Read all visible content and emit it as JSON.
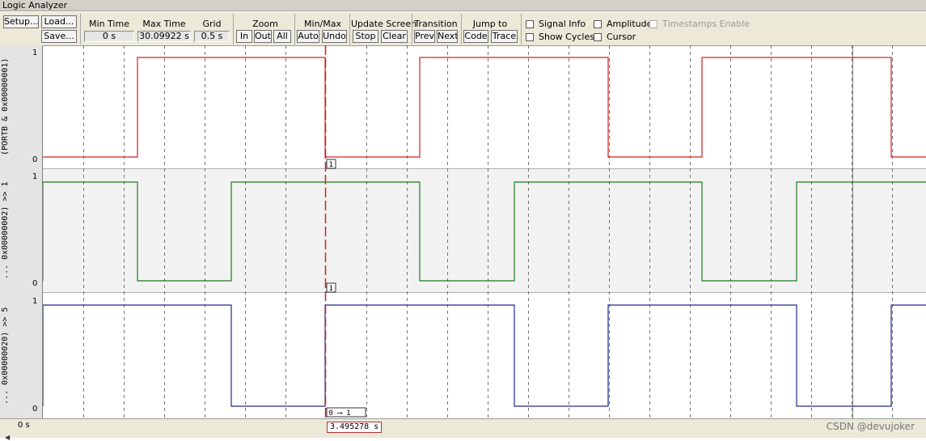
{
  "window": {
    "title": "Logic Analyzer"
  },
  "toolbar": {
    "setup_label": "Setup...",
    "load_label": "Load...",
    "save_label": "Save...",
    "min_time": {
      "label": "Min Time",
      "value": "0 s"
    },
    "max_time": {
      "label": "Max Time",
      "value": "30.09922 s"
    },
    "grid": {
      "label": "Grid",
      "value": "0.5 s"
    },
    "zoom": {
      "label": "Zoom",
      "in": "In",
      "out": "Out",
      "all": "All"
    },
    "minmax": {
      "label": "Min/Max",
      "auto": "Auto",
      "undo": "Undo"
    },
    "update": {
      "label": "Update Screen",
      "stop": "Stop",
      "clear": "Clear"
    },
    "transition": {
      "label": "Transition",
      "prev": "Prev",
      "next": "Next"
    },
    "jumpto": {
      "label": "Jump to",
      "code": "Code",
      "trace": "Trace"
    },
    "checkboxes": {
      "signal_info": "Signal Info",
      "show_cycles": "Show Cycles",
      "amplitude": "Amplitude",
      "cursor": "Cursor",
      "timestamps": "Timestamps Enable"
    }
  },
  "signals": [
    {
      "label": "(PORTB & 0x00000001)",
      "high": "1",
      "low": "0",
      "color": "#d02020",
      "marker": "1"
    },
    {
      "label": "... 0x00000002) >> 1",
      "high": "1",
      "low": "0",
      "color": "#1e7a1e",
      "marker": "1"
    },
    {
      "label": "... 0x00000020) >> 5",
      "high": "1",
      "low": "0",
      "color": "#1c2a8a",
      "marker": "0 ⟶ 1"
    }
  ],
  "timeline": {
    "start": "0 s",
    "cursor_time": "3.495278 s"
  },
  "watermark": "CSDN @devujoker"
}
